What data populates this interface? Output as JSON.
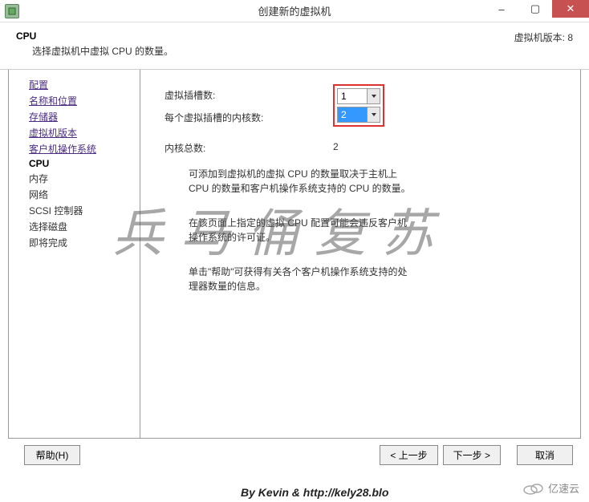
{
  "window": {
    "title": "创建新的虚拟机",
    "minimize": "–",
    "maximize": "▢",
    "close": "✕"
  },
  "header": {
    "title": "CPU",
    "description": "选择虚拟机中虚拟 CPU 的数量。",
    "version_label": "虚拟机版本: 8"
  },
  "sidebar": {
    "items": [
      {
        "label": "配置",
        "type": "link"
      },
      {
        "label": "名称和位置",
        "type": "link"
      },
      {
        "label": "存储器",
        "type": "link"
      },
      {
        "label": "虚拟机版本",
        "type": "link"
      },
      {
        "label": "客户机操作系统",
        "type": "link"
      },
      {
        "label": "CPU",
        "type": "current"
      },
      {
        "label": "内存",
        "type": "text"
      },
      {
        "label": "网络",
        "type": "text"
      },
      {
        "label": "SCSI 控制器",
        "type": "text"
      },
      {
        "label": "选择磁盘",
        "type": "text"
      },
      {
        "label": "即将完成",
        "type": "text"
      }
    ]
  },
  "form": {
    "sockets_label": "虚拟插槽数:",
    "sockets_value": "1",
    "cores_label": "每个虚拟插槽的内核数:",
    "cores_value": "2",
    "total_label": "内核总数:",
    "total_value": "2"
  },
  "info": {
    "p1": "可添加到虚拟机的虚拟 CPU 的数量取决于主机上 CPU 的数量和客户机操作系统支持的 CPU 的数量。",
    "p2": "在该页面上指定的虚拟 CPU 配置可能会违反客户机操作系统的许可证。",
    "p3": "单击\"帮助\"可获得有关各个客户机操作系统支持的处理器数量的信息。"
  },
  "footer": {
    "help": "帮助(H)",
    "back": "< 上一步",
    "next": "下一步 >",
    "cancel": "取消"
  },
  "watermark": "兵马俑复苏",
  "attribution": "By Kevin & http://kely28.blo",
  "corner_logo": "亿速云"
}
